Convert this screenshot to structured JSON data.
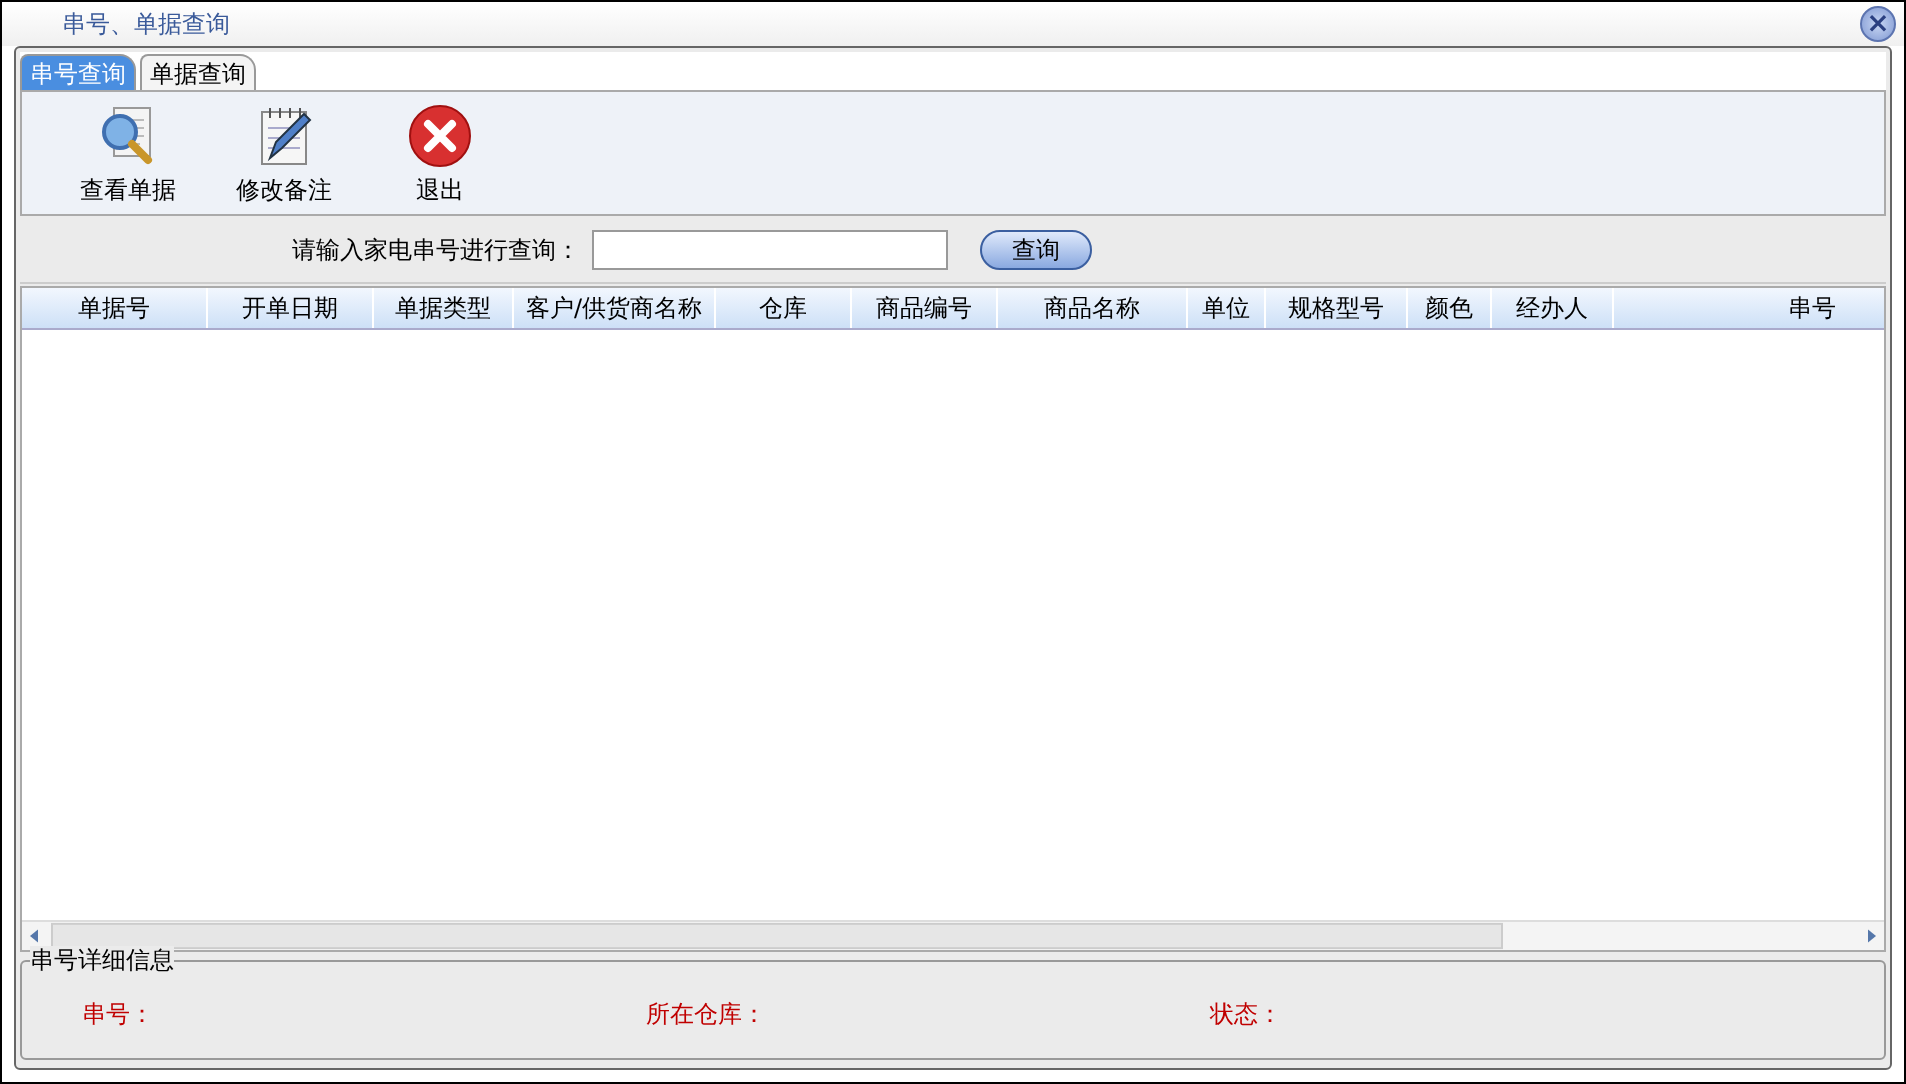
{
  "window": {
    "title": "串号、单据查询",
    "close": "×"
  },
  "tabs": [
    {
      "label": "串号查询",
      "selected": true
    },
    {
      "label": "单据查询",
      "selected": false
    }
  ],
  "toolbar": [
    {
      "label": "查看单据",
      "kind": "view"
    },
    {
      "label": "修改备注",
      "kind": "edit"
    },
    {
      "label": "退出",
      "kind": "exit"
    }
  ],
  "search": {
    "label": "请输入家电串号进行查询：",
    "button": "查询"
  },
  "table": {
    "columns": [
      "单据号",
      "开单日期",
      "单据类型",
      "客户/供货商名称",
      "仓库",
      "商品编号",
      "商品名称",
      "单位",
      "规格型号",
      "颜色",
      "经办人",
      "串号"
    ]
  },
  "details": {
    "title": "串号详细信息",
    "fields": [
      "串号：",
      "所在仓库：",
      "状态："
    ]
  }
}
